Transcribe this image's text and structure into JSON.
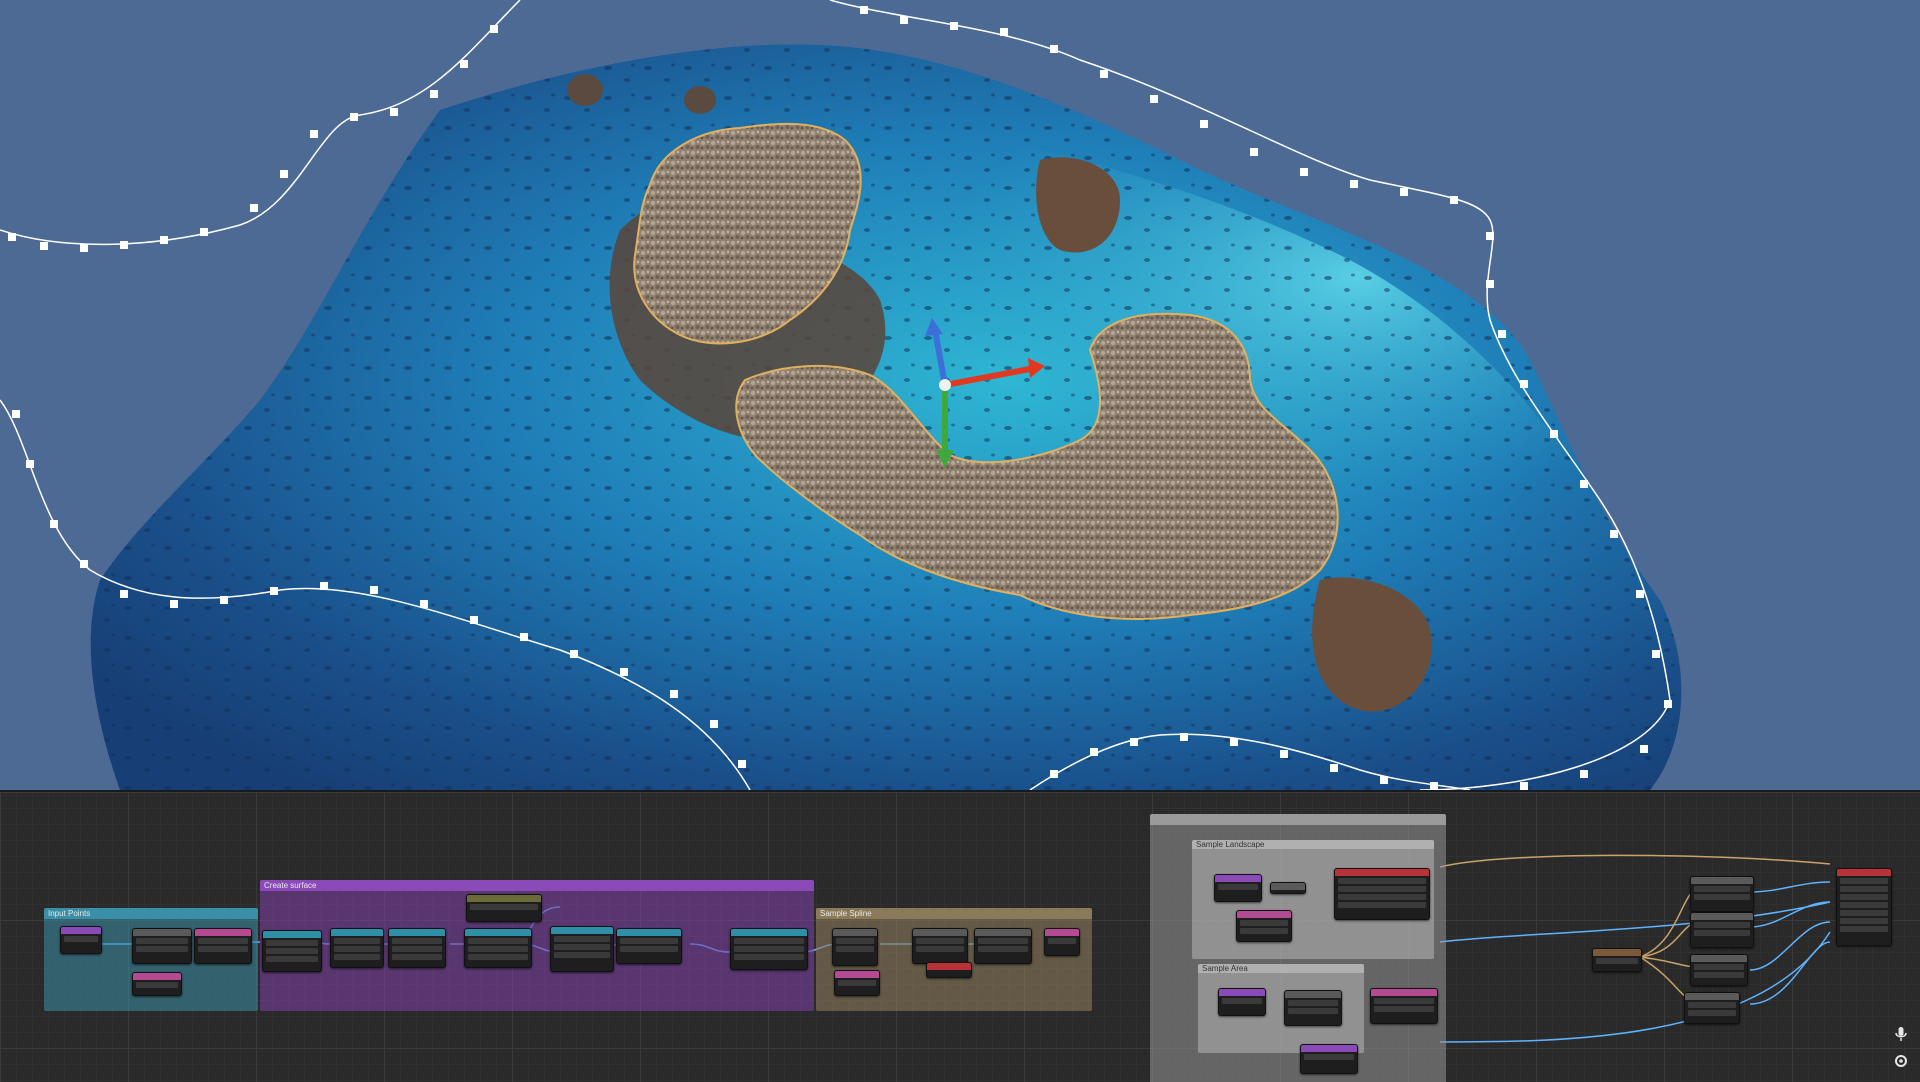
{
  "viewport": {
    "background_color": "#4d6a94",
    "spline_color": "#ffffff",
    "selection_outline_color": "#e0b060",
    "gizmo": {
      "x_axis_color": "#e0391f",
      "y_axis_color": "#3fa83a",
      "z_axis_color": "#3d6fd8"
    }
  },
  "graph": {
    "groups": {
      "input_points": {
        "title": "Input Points",
        "color": "#3a8ea5"
      },
      "create_surface": {
        "title": "Create surface",
        "color": "#7a3fa0"
      },
      "sample_spline": {
        "title": "Sample Spline",
        "color": "#8a7a5a"
      },
      "sample_landscape": {
        "title": "Sample Landscape",
        "color": "#9a9a9a"
      },
      "sample_area": {
        "title": "Sample Area",
        "color": "#9a9a9a"
      }
    },
    "node_header_colors": {
      "teal": "#2f8fa8",
      "grey": "#5a5a5a",
      "purple": "#8a4bb8",
      "red": "#b8323a",
      "pink": "#b44b92",
      "olive": "#6d6a3a",
      "brown": "#7a5a3a"
    }
  },
  "side_icons": {
    "microphone": "microphone-icon",
    "settings": "gear-icon"
  }
}
